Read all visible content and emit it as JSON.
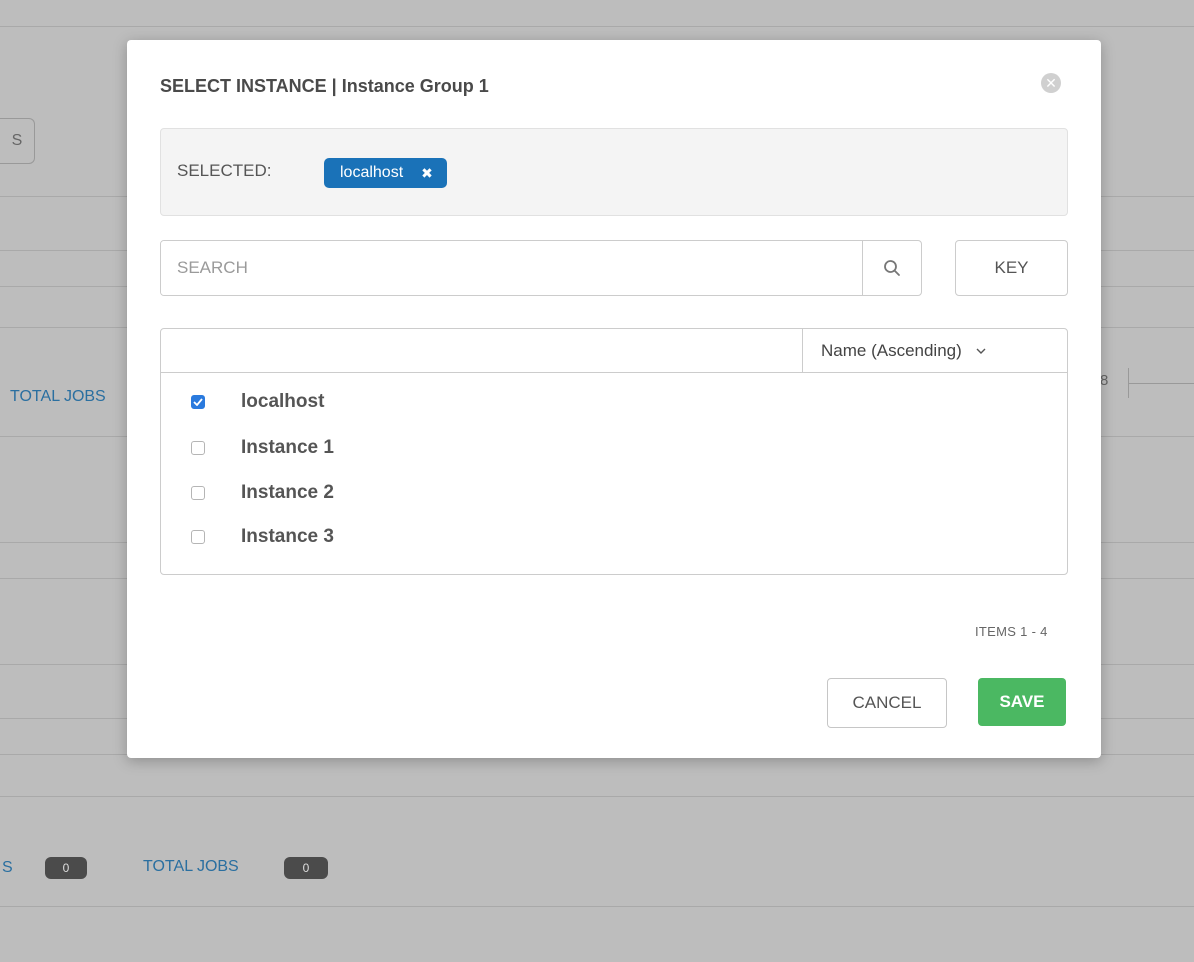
{
  "modal": {
    "title": "SELECT INSTANCE | Instance Group 1",
    "close_icon": "x-circle-icon",
    "selected_label": "SELECTED:",
    "selected_tags": [
      {
        "label": "localhost",
        "remove": "✖"
      }
    ],
    "search": {
      "placeholder": "SEARCH",
      "icon": "search-icon"
    },
    "key_label": "KEY",
    "sort_label": "Name (Ascending)",
    "sort_chevron": "⌄",
    "rows": [
      {
        "label": "localhost",
        "checked": true
      },
      {
        "label": "Instance 1",
        "checked": false
      },
      {
        "label": "Instance 2",
        "checked": false
      },
      {
        "label": "Instance 3",
        "checked": false
      }
    ],
    "items": "ITEMS  1 - 4",
    "cancel_label": "CANCEL",
    "save_label": "SAVE"
  },
  "background": {
    "edge_button_text": "S",
    "total_jobs_label_top": "TOTAL JOBS",
    "right_number": "8",
    "bottom_left_fragment": "S",
    "badge_left_value": "0",
    "total_jobs_label_bottom": "TOTAL JOBS",
    "badge_right_value": "0"
  },
  "colors": {
    "accent_blue": "#1a72b8",
    "checkbox_blue": "#2a7ade",
    "save_green": "#4bb862",
    "link_blue": "#2a6fa0"
  }
}
